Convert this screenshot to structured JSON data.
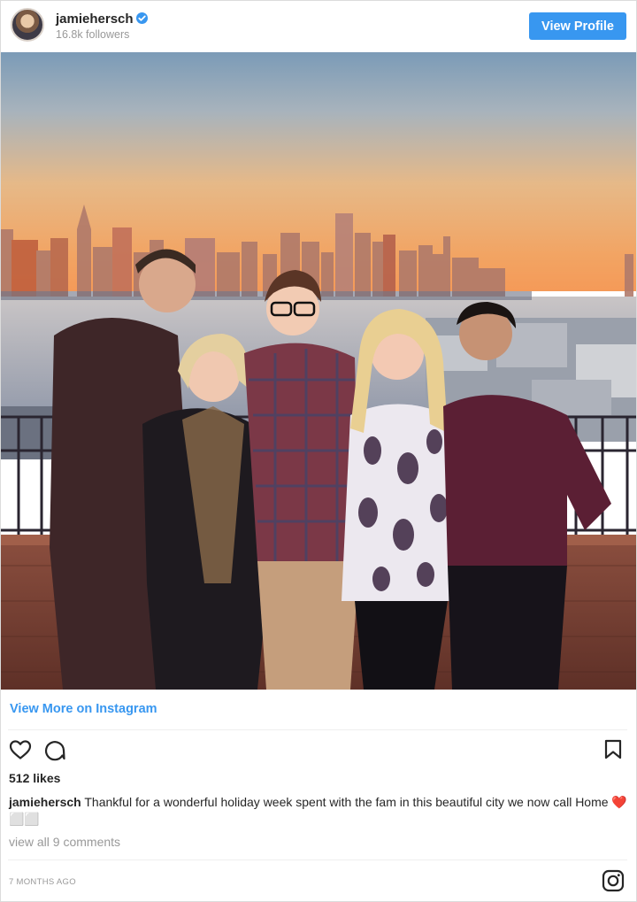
{
  "header": {
    "username": "jamiehersch",
    "followers": "16.8k followers",
    "view_profile_label": "View Profile",
    "verified_icon": "verified-badge-icon"
  },
  "colors": {
    "accent": "#3897f0",
    "text": "#262626",
    "muted": "#999999"
  },
  "photo": {
    "description_icon": "family-photo"
  },
  "footer": {
    "view_more_label": "View More on Instagram",
    "likes": "512 likes",
    "caption_user": "jamiehersch",
    "caption_text": "Thankful for a wonderful holiday week spent with the fam in this beautiful city we now call Home ❤️⬜⬜",
    "view_comments": "view all 9 comments",
    "timestamp": "7 MONTHS AGO",
    "icons": [
      "heart-icon",
      "comment-icon",
      "bookmark-icon",
      "instagram-icon"
    ]
  }
}
